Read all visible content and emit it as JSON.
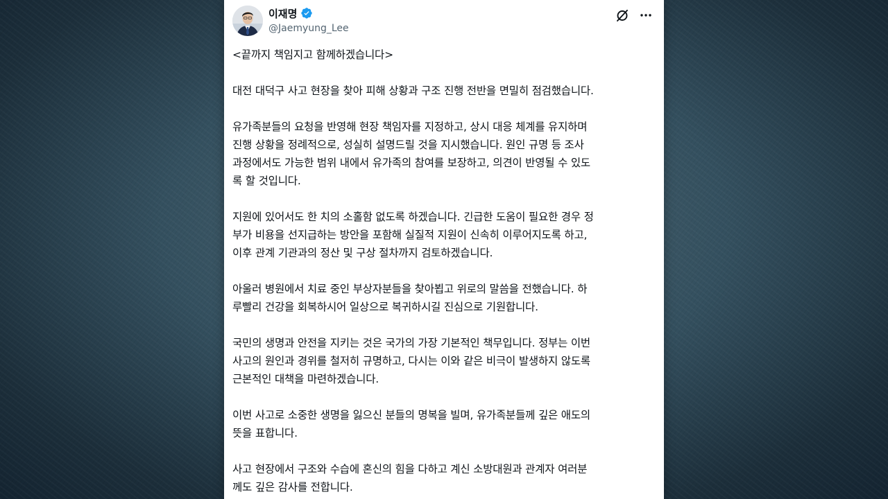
{
  "tweet": {
    "author": {
      "display_name": "이재명",
      "handle": "@Jaemyung_Lee",
      "verified": true
    },
    "paragraphs": [
      "<끝까지 책임지고 함께하겠습니다>",
      "대전 대덕구 사고 현장을 찾아 피해 상황과 구조 진행 전반을 면밀히 점검했습니다.",
      "유가족분들의 요청을 반영해 현장 책임자를 지정하고, 상시 대응 체계를 유지하며\n진행 상황을 정례적으로, 성실히 설명드릴 것을 지시했습니다. 원인 규명 등 조사\n과정에서도 가능한 범위 내에서 유가족의 참여를 보장하고, 의견이 반영될 수 있도\n록 할 것입니다.",
      "지원에 있어서도 한 치의 소홀함 없도록 하겠습니다. 긴급한 도움이 필요한 경우 정\n부가 비용을 선지급하는 방안을 포함해 실질적 지원이 신속히 이루어지도록 하고,\n이후 관계 기관과의 정산 및 구상 절차까지 검토하겠습니다.",
      "아울러 병원에서 치료 중인 부상자분들을 찾아뵙고 위로의 말씀을 전했습니다. 하\n루빨리 건강을 회복하시어 일상으로 복귀하시길 진심으로 기원합니다.",
      "국민의 생명과 안전을 지키는 것은 국가의 가장 기본적인 책무입니다. 정부는 이번\n사고의 원인과 경위를 철저히 규명하고, 다시는 이와 같은 비극이 발생하지 않도록\n근본적인 대책을 마련하겠습니다.",
      "이번 사고로 소중한 생명을 잃으신 분들의 명복을 빌며, 유가족분들께 깊은 애도의\n뜻을 표합니다.",
      "사고 현장에서 구조와 수습에 혼신의 힘을 다하고 계신 소방대원과 관계자 여러분\n께도 깊은 감사를 전합니다."
    ]
  },
  "icons": {
    "verified": "verified-badge-icon",
    "grok": "grok-icon",
    "more": "more-options-icon"
  },
  "colors": {
    "verified_blue": "#1d9bf0",
    "text_primary": "#0f1419",
    "text_secondary": "#536471",
    "backdrop": "#34505f"
  }
}
